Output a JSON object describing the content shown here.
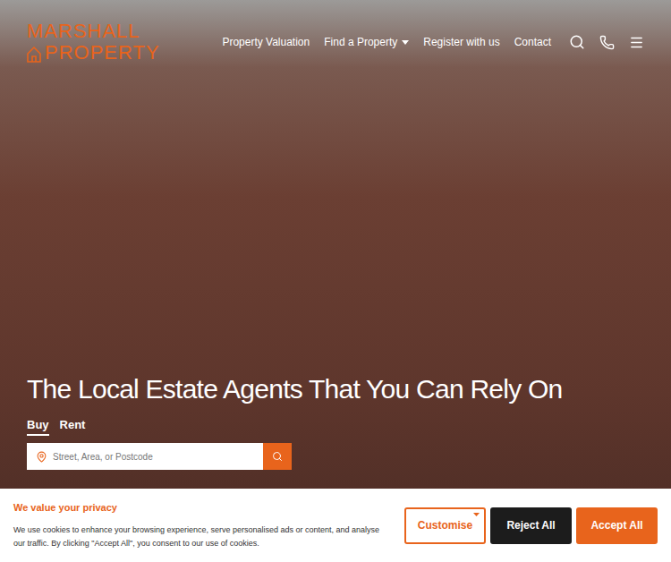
{
  "header": {
    "logo": {
      "top": "MARSHALL",
      "bottom": "PROPERTY"
    },
    "nav": [
      {
        "label": "Property Valuation",
        "has_dropdown": false
      },
      {
        "label": "Find a Property",
        "has_dropdown": true
      },
      {
        "label": "Register with us",
        "has_dropdown": false
      },
      {
        "label": "Contact",
        "has_dropdown": false
      }
    ]
  },
  "hero": {
    "heading": "The Local Estate Agents That You Can Rely On",
    "tabs": [
      {
        "label": "Buy",
        "selected": true
      },
      {
        "label": "Rent",
        "selected": false
      }
    ],
    "search": {
      "placeholder": "Street, Area, or Postcode"
    }
  },
  "cookie_banner": {
    "title": "We value your privacy",
    "text": "We use cookies to enhance your browsing experience, serve personalised ads or content, and analyse our traffic. By clicking \"Accept All\", you consent to our use of cookies.",
    "buttons": [
      {
        "label": "Customise",
        "kind": "outline"
      },
      {
        "label": "Reject All",
        "kind": "dark"
      },
      {
        "label": "Accept All",
        "kind": "primary"
      }
    ]
  }
}
